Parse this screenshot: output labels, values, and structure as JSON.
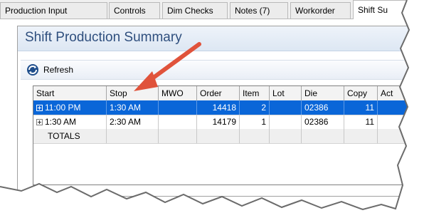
{
  "tabs": [
    {
      "label": "Production Input",
      "active": false
    },
    {
      "label": "Controls",
      "active": false
    },
    {
      "label": "Dim Checks",
      "active": false
    },
    {
      "label": "Notes (7)",
      "active": false
    },
    {
      "label": "Workorder",
      "active": false
    },
    {
      "label": "Shift Su",
      "active": true
    }
  ],
  "panel": {
    "title": "Shift Production Summary",
    "refresh_label": "Refresh"
  },
  "grid": {
    "columns": [
      "Start",
      "Stop",
      "MWO",
      "Order",
      "Item",
      "Lot",
      "Die",
      "Copy",
      "Act"
    ],
    "rows": [
      {
        "start": "11:00 PM",
        "stop": "1:30 AM",
        "mwo": "",
        "order": "14418",
        "item": "2",
        "lot": "",
        "die": "02386",
        "copy": "11",
        "selected": true,
        "expandable": true
      },
      {
        "start": "1:30 AM",
        "stop": "2:30 AM",
        "mwo": "",
        "order": "14179",
        "item": "1",
        "lot": "",
        "die": "02386",
        "copy": "11",
        "selected": false,
        "expandable": true
      },
      {
        "start": "TOTALS",
        "stop": "",
        "mwo": "",
        "order": "",
        "item": "",
        "lot": "",
        "die": "",
        "copy": "",
        "selected": false,
        "expandable": false
      }
    ]
  },
  "colors": {
    "selection": "#0a66d8",
    "title_text": "#2f4f7e",
    "arrow": "#e0533b"
  },
  "icons": {
    "refresh": "refresh-icon",
    "expand": "plus-expander-icon",
    "annotation": "arrow-icon"
  }
}
